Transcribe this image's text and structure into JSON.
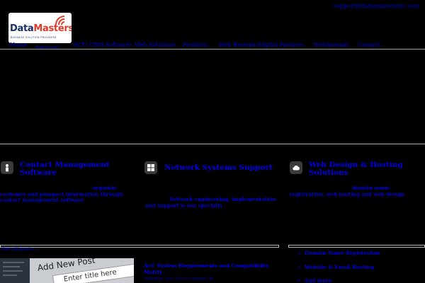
{
  "header": {
    "support_email": "support@datamastersinc.com"
  },
  "logo": {
    "wordmark_a": "Data",
    "wordmark_b": "Masters",
    "tagline": "BUSINESS SOLUTION PROVIDERS"
  },
  "nav": {
    "items": [
      "Home",
      "Services",
      "ACT! CRM Software",
      "Web Solutions",
      "Products",
      "Web Reseller/Digital Partners",
      "Testimonials",
      "Contact"
    ]
  },
  "features": [
    {
      "icon": "person-icon",
      "title_line1": "Contact Management",
      "title_line2": "Software",
      "desc_line1": "organize",
      "desc_line2": "customer and prospect information through",
      "desc_line3": "contact management software"
    },
    {
      "icon": "windows-icon",
      "title_line1": "Network Systems Support",
      "desc_line1": "Network engineering, implementation",
      "desc_line2": "and support is our specialty"
    },
    {
      "icon": "cloud-icon",
      "title_line1": "Web Design & Hosting",
      "title_line2": "Solutions",
      "desc_line1": "domain name",
      "desc_line2": "registration, web hosting and web design"
    }
  ],
  "posts": {
    "see_all": "See all posts »",
    "thumb_heading": "Add New Post",
    "thumb_input": "Enter title here",
    "latest_title": "Act! System Requirements and Compatibility Matrix",
    "latest_meta": "September 11th, 2018 | Comments Off"
  },
  "sidebar": {
    "bullet": "»",
    "items": [
      "Domain Name Registration",
      "Website & Email Hosting",
      "And more"
    ]
  },
  "colors": {
    "link": "#0000d0",
    "background": "#000000",
    "logo_navy": "#1a2f63",
    "logo_red": "#e03a2a"
  }
}
